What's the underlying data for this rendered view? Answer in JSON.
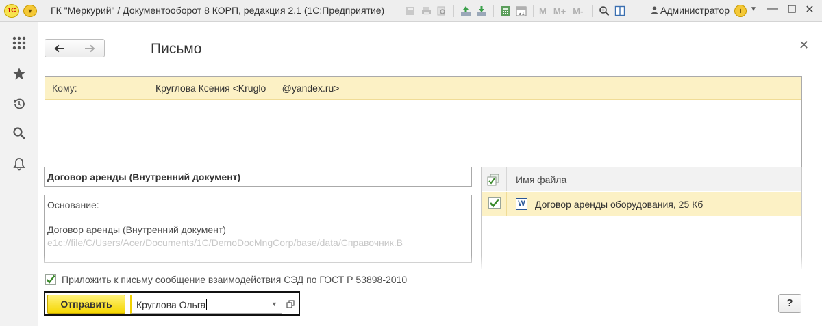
{
  "window": {
    "title": "ГК \"Меркурий\" / Документооборот 8 КОРП, редакция 2.1  (1С:Предприятие)",
    "logo_text": "1С",
    "user": "Администратор",
    "toolbar_m_labels": [
      "M",
      "M+",
      "M-"
    ]
  },
  "sidebar": {
    "items": [
      "apps-grid-icon",
      "star-icon",
      "history-icon",
      "search-icon",
      "bell-icon"
    ]
  },
  "form": {
    "title": "Письмо",
    "to_label": "Кому:",
    "to_value": "Круглова Ксения <Kruglo      @yandex.ru>",
    "subject": "Договор аренды (Внутренний документ)",
    "body_lines": [
      "Основание:",
      "Договор аренды (Внутренний документ)",
      "e1c://file/C/Users/Acer/Documents/1C/DemoDocMngCorp/base/data/Справочник.В"
    ],
    "files": {
      "header": "Имя файла",
      "rows": [
        {
          "name": "Договор аренды оборудования, 25 Кб",
          "checked": true
        }
      ]
    },
    "attach_checkbox": {
      "label": "Приложить к письму сообщение взаимодействия СЭД по ГОСТ Р 53898-2010",
      "checked": true
    },
    "send_button": "Отправить",
    "responsible": "Круглова Ольга",
    "help_button": "?"
  },
  "colors": {
    "highlight_row": "#fcf1c5",
    "send_button": "#f5d600",
    "check_green": "#3a8a2a",
    "word_blue": "#2b5797"
  }
}
